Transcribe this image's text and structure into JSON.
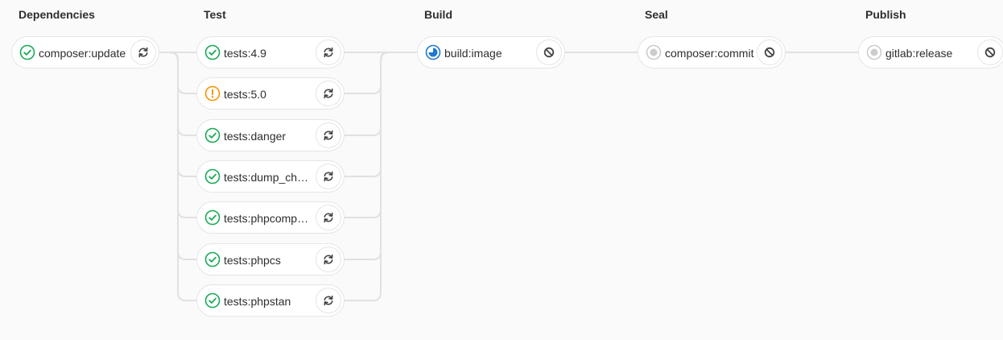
{
  "stages": [
    {
      "title": "Dependencies",
      "jobs": [
        {
          "name": "composer:update",
          "status": "success",
          "status_icon": "check-circle-icon",
          "action": "retry",
          "action_icon": "retry-icon"
        }
      ]
    },
    {
      "title": "Test",
      "jobs": [
        {
          "name": "tests:4.9",
          "status": "success",
          "status_icon": "check-circle-icon",
          "action": "retry",
          "action_icon": "retry-icon"
        },
        {
          "name": "tests:5.0",
          "status": "warning",
          "status_icon": "warning-circle-icon",
          "action": "retry",
          "action_icon": "retry-icon"
        },
        {
          "name": "tests:danger",
          "status": "success",
          "status_icon": "check-circle-icon",
          "action": "retry",
          "action_icon": "retry-icon"
        },
        {
          "name": "tests:dump_changelog",
          "status": "success",
          "status_icon": "check-circle-icon",
          "action": "retry",
          "action_icon": "retry-icon"
        },
        {
          "name": "tests:phpcompatibility",
          "status": "success",
          "status_icon": "check-circle-icon",
          "action": "retry",
          "action_icon": "retry-icon"
        },
        {
          "name": "tests:phpcs",
          "status": "success",
          "status_icon": "check-circle-icon",
          "action": "retry",
          "action_icon": "retry-icon"
        },
        {
          "name": "tests:phpstan",
          "status": "success",
          "status_icon": "check-circle-icon",
          "action": "retry",
          "action_icon": "retry-icon"
        }
      ]
    },
    {
      "title": "Build",
      "jobs": [
        {
          "name": "build:image",
          "status": "running",
          "status_icon": "running-icon",
          "action": "cancel",
          "action_icon": "cancel-icon"
        }
      ]
    },
    {
      "title": "Seal",
      "jobs": [
        {
          "name": "composer:commit",
          "status": "created",
          "status_icon": "created-icon",
          "action": "cancel",
          "action_icon": "cancel-icon"
        }
      ]
    },
    {
      "title": "Publish",
      "jobs": [
        {
          "name": "gitlab:release",
          "status": "created",
          "status_icon": "created-icon",
          "action": "cancel",
          "action_icon": "cancel-icon"
        }
      ]
    }
  ],
  "colors": {
    "success": "#1aaa55",
    "warning": "#fc9403",
    "running": "#1f78d1",
    "created": "#cccccc",
    "connector": "#e1e1e1",
    "action_icon": "#444444"
  }
}
